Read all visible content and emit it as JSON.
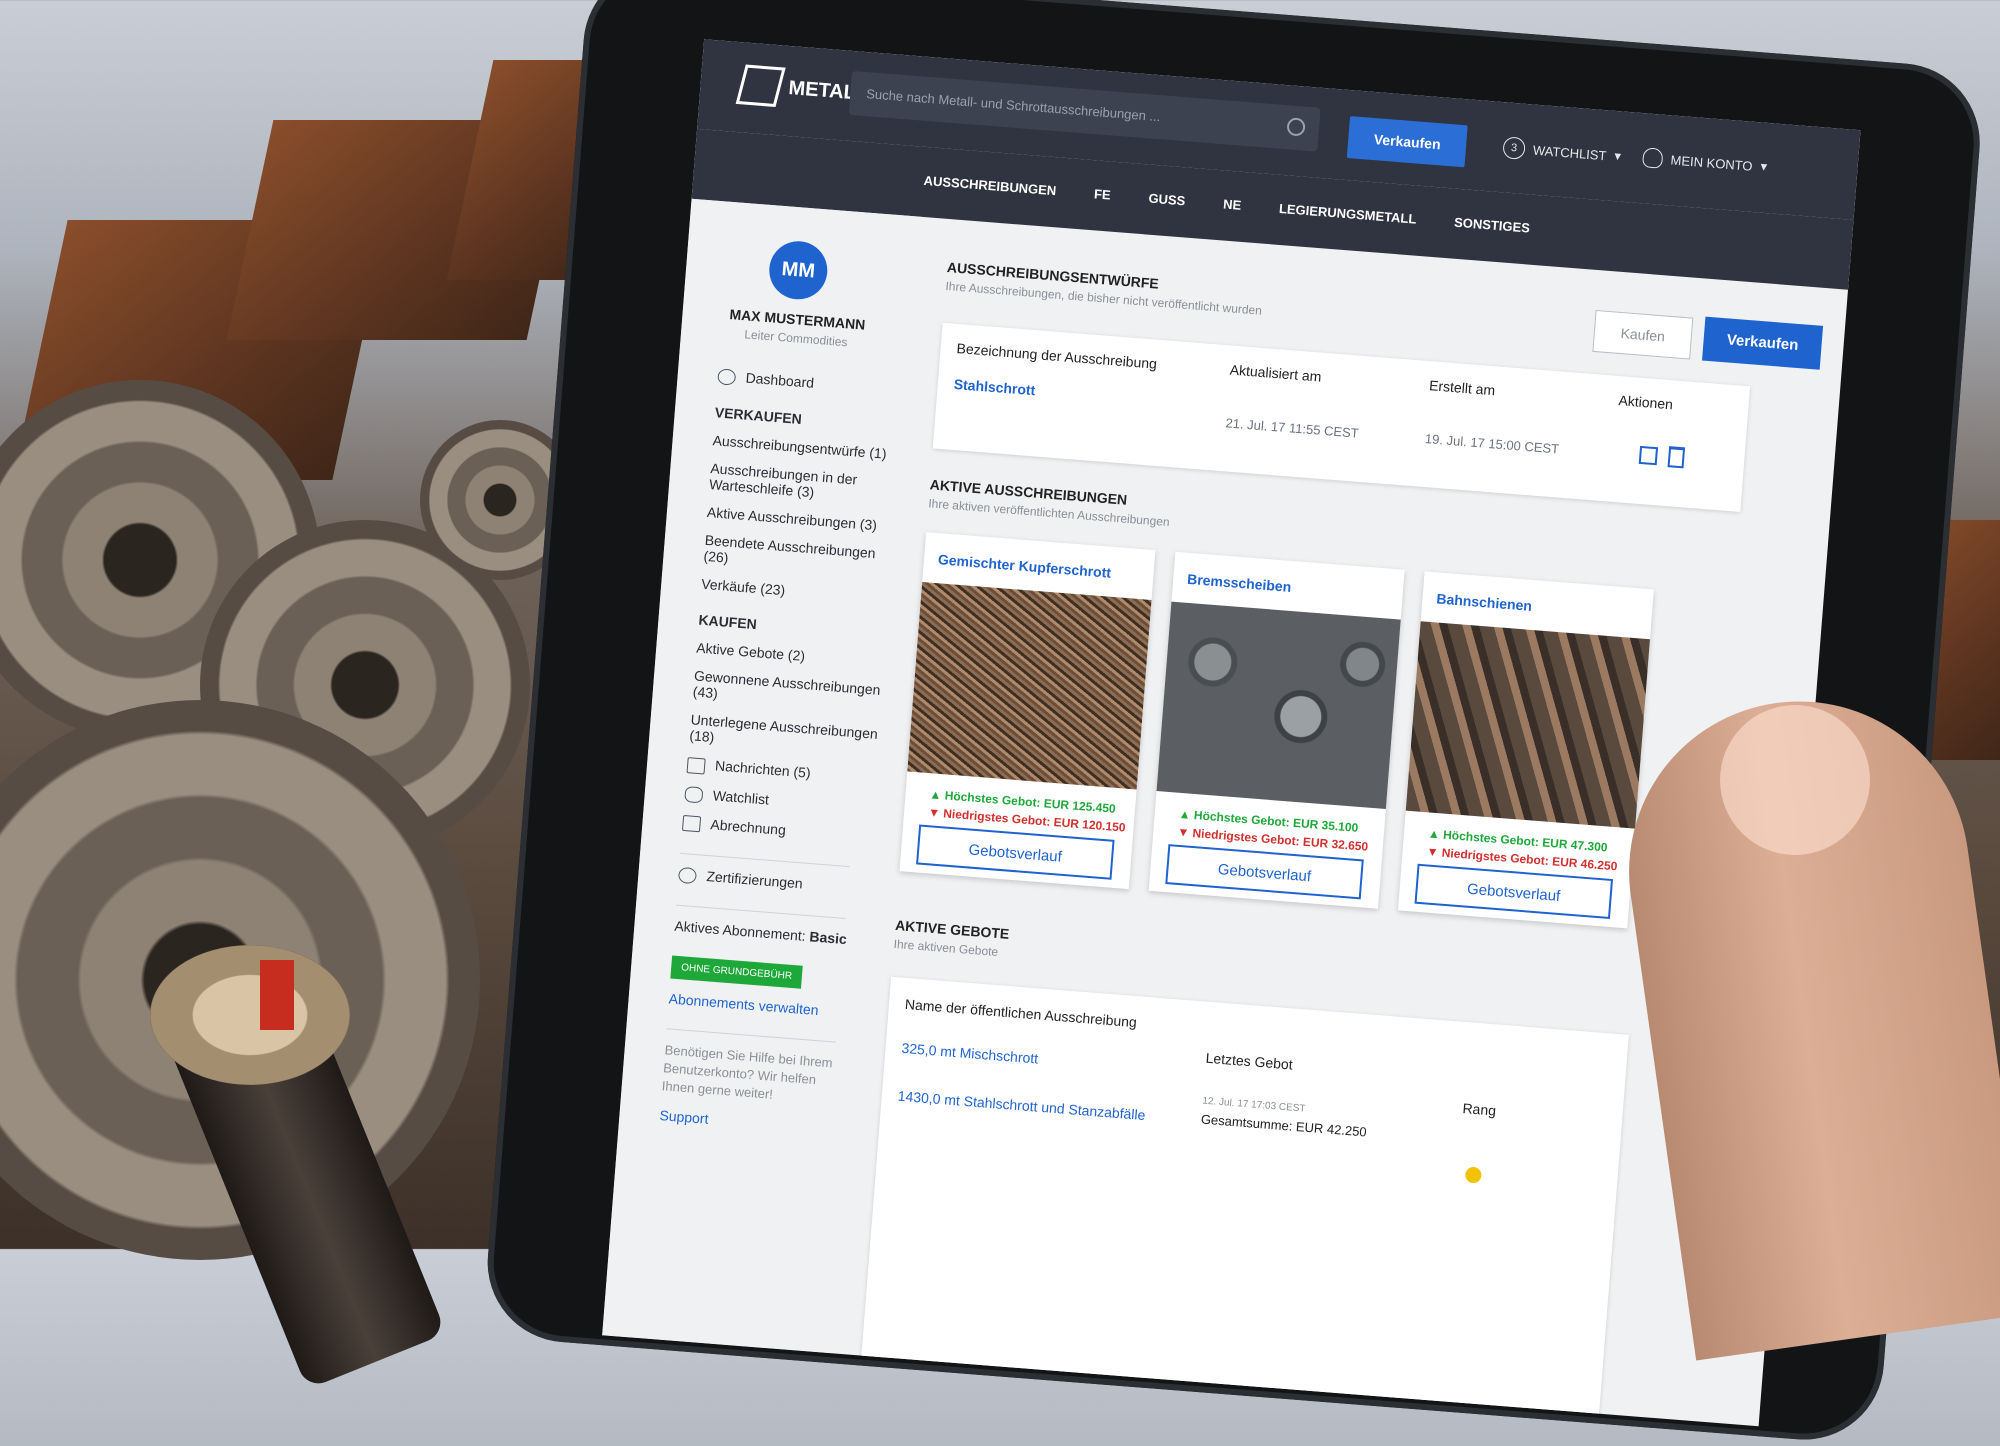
{
  "header": {
    "logo": "METAL XCHANGE",
    "search_placeholder": "Suche nach Metall- und Schrottausschreibungen ...",
    "sell_button": "Verkaufen",
    "watchlist_count": "3",
    "watchlist_label": "WATCHLIST",
    "account_label": "MEIN KONTO"
  },
  "nav": [
    "AUSSCHREIBUNGEN",
    "FE",
    "GUSS",
    "NE",
    "LEGIERUNGSMETALL",
    "SONSTIGES"
  ],
  "user": {
    "initials": "MM",
    "name": "MAX MUSTERMANN",
    "role": "Leiter Commodities"
  },
  "sidebar": {
    "dashboard": "Dashboard",
    "sell_heading": "VERKAUFEN",
    "sell_items": [
      "Ausschreibungsentwürfe (1)",
      "Ausschreibungen in der Warteschleife (3)",
      "Aktive Ausschreibungen (3)",
      "Beendete Ausschreibungen (26)",
      "Verkäufe (23)"
    ],
    "buy_heading": "KAUFEN",
    "buy_items": [
      "Aktive Gebote (2)",
      "Gewonnene Ausschreibungen (43)",
      "Unterlegene Ausschreibungen (18)"
    ],
    "messages": "Nachrichten (5)",
    "watchlist": "Watchlist",
    "billing": "Abrechnung",
    "certifications": "Zertifizierungen",
    "subscription_label": "Aktives Abonnement:",
    "subscription_value": "Basic",
    "subscription_badge": "OHNE GRUNDGEBÜHR",
    "manage_subscriptions": "Abonnements verwalten",
    "help_text": "Benötigen Sie Hilfe bei Ihrem Benutzerkonto? Wir helfen Ihnen gerne weiter!",
    "support": "Support"
  },
  "drafts": {
    "title": "AUSSCHREIBUNGSENTWÜRFE",
    "subtitle": "Ihre Ausschreibungen, die bisher nicht veröffentlicht wurden",
    "buy_button": "Kaufen",
    "sell_button": "Verkaufen",
    "columns": [
      "Bezeichnung der Ausschreibung",
      "Aktualisiert am",
      "Erstellt am",
      "Aktionen"
    ],
    "rows": [
      {
        "name": "Stahlschrott",
        "updated": "21. Jul. 17 11:55 CEST",
        "created": "19. Jul. 17 15:00 CEST"
      }
    ]
  },
  "active_tenders": {
    "title": "AKTIVE AUSSCHREIBUNGEN",
    "subtitle": "Ihre aktiven veröffentlichten Ausschreibungen",
    "cards": [
      {
        "title": "Gemischter Kupferschrott",
        "high": "Höchstes Gebot: EUR 125.450",
        "low": "Niedrigstes Gebot: EUR 120.150",
        "button": "Gebotsverlauf"
      },
      {
        "title": "Bremsscheiben",
        "high": "Höchstes Gebot: EUR 35.100",
        "low": "Niedrigstes Gebot: EUR 32.650",
        "button": "Gebotsverlauf"
      },
      {
        "title": "Bahnschienen",
        "high": "Höchstes Gebot: EUR 47.300",
        "low": "Niedrigstes Gebot: EUR 46.250",
        "button": "Gebotsverlauf"
      }
    ]
  },
  "active_bids": {
    "title": "AKTIVE GEBOTE",
    "subtitle": "Ihre aktiven Gebote",
    "columns": [
      "Name der öffentlichen Ausschreibung",
      "Letztes Gebot",
      "Rang"
    ],
    "rows": [
      {
        "name": "325,0 mt Mischschrott",
        "date": "12. Jul. 17 17:03 CEST",
        "total": "Gesamtsumme: EUR 42.250"
      },
      {
        "name": "1430,0 mt Stahlschrott und Stanzabfälle"
      }
    ]
  },
  "colors": {
    "primary": "#1f63cf",
    "topbar": "#2f3440",
    "green": "#1ea83a",
    "red": "#d32f2f",
    "rank_dot": "#f2c200"
  }
}
